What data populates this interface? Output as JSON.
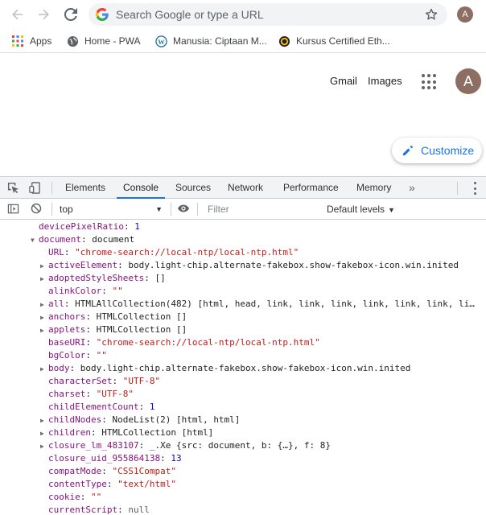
{
  "browser": {
    "omnibox_placeholder": "Search Google or type a URL",
    "profile_initial": "A"
  },
  "bookmarks": [
    {
      "label": "Apps",
      "icon": "apps-grid-icon"
    },
    {
      "label": "Home - PWA",
      "icon": "globe-icon"
    },
    {
      "label": "Manusia: Ciptaan M...",
      "icon": "wordpress-icon"
    },
    {
      "label": "Kursus Certified Eth...",
      "icon": "site-logo-icon"
    }
  ],
  "page": {
    "gmail": "Gmail",
    "images": "Images",
    "avatar_initial": "A",
    "customize": "Customize"
  },
  "devtools": {
    "tabs": [
      "Elements",
      "Console",
      "Sources",
      "Network",
      "Performance",
      "Memory"
    ],
    "active_tab": "Console",
    "more": "»",
    "context": "top",
    "filter_placeholder": "Filter",
    "levels": "Default levels"
  },
  "console": [
    {
      "indent": 0,
      "tri": "",
      "key": "devicePixelRatio",
      "value": "1",
      "type": "n",
      "keystyle": "k"
    },
    {
      "indent": 0,
      "tri": "▼",
      "key": "document",
      "value": "document",
      "type": "o",
      "keystyle": "k"
    },
    {
      "indent": 1,
      "tri": "",
      "key": "URL",
      "value": "\"chrome-search://local-ntp/local-ntp.html\"",
      "type": "s",
      "keystyle": "k"
    },
    {
      "indent": 1,
      "tri": "▶",
      "key": "activeElement",
      "value": "body.light-chip.alternate-fakebox.show-fakebox-icon.win.inited",
      "type": "o",
      "keystyle": "k"
    },
    {
      "indent": 1,
      "tri": "▶",
      "key": "adoptedStyleSheets",
      "value": "[]",
      "type": "o",
      "keystyle": "k"
    },
    {
      "indent": 1,
      "tri": "",
      "key": "alinkColor",
      "value": "\"\"",
      "type": "s",
      "keystyle": "k"
    },
    {
      "indent": 1,
      "tri": "▶",
      "key": "all",
      "value": "HTMLAllCollection(482) [html, head, link, link, link, link, link, link, li…",
      "type": "o",
      "keystyle": "k"
    },
    {
      "indent": 1,
      "tri": "▶",
      "key": "anchors",
      "value": "HTMLCollection []",
      "type": "o",
      "keystyle": "k"
    },
    {
      "indent": 1,
      "tri": "▶",
      "key": "applets",
      "value": "HTMLCollection []",
      "type": "o",
      "keystyle": "k"
    },
    {
      "indent": 1,
      "tri": "",
      "key": "baseURI",
      "value": "\"chrome-search://local-ntp/local-ntp.html\"",
      "type": "s",
      "keystyle": "k"
    },
    {
      "indent": 1,
      "tri": "",
      "key": "bgColor",
      "value": "\"\"",
      "type": "s",
      "keystyle": "k"
    },
    {
      "indent": 1,
      "tri": "▶",
      "key": "body",
      "value": "body.light-chip.alternate-fakebox.show-fakebox-icon.win.inited",
      "type": "o",
      "keystyle": "k"
    },
    {
      "indent": 1,
      "tri": "",
      "key": "characterSet",
      "value": "\"UTF-8\"",
      "type": "s",
      "keystyle": "k"
    },
    {
      "indent": 1,
      "tri": "",
      "key": "charset",
      "value": "\"UTF-8\"",
      "type": "s",
      "keystyle": "k"
    },
    {
      "indent": 1,
      "tri": "",
      "key": "childElementCount",
      "value": "1",
      "type": "n",
      "keystyle": "k"
    },
    {
      "indent": 1,
      "tri": "▶",
      "key": "childNodes",
      "value": "NodeList(2) [html, html]",
      "type": "o",
      "keystyle": "k"
    },
    {
      "indent": 1,
      "tri": "▶",
      "key": "children",
      "value": "HTMLCollection [html]",
      "type": "o",
      "keystyle": "k"
    },
    {
      "indent": 1,
      "tri": "▶",
      "key": "closure_lm_483107",
      "value": "_.Xe {src: document, b: {…}, f: 8}",
      "type": "o",
      "keystyle": "k"
    },
    {
      "indent": 1,
      "tri": "",
      "key": "closure_uid_955864138",
      "value": "13",
      "type": "n",
      "keystyle": "k"
    },
    {
      "indent": 1,
      "tri": "",
      "key": "compatMode",
      "value": "\"CSS1Compat\"",
      "type": "s",
      "keystyle": "k"
    },
    {
      "indent": 1,
      "tri": "",
      "key": "contentType",
      "value": "\"text/html\"",
      "type": "s",
      "keystyle": "k"
    },
    {
      "indent": 1,
      "tri": "",
      "key": "cookie",
      "value": "\"\"",
      "type": "s",
      "keystyle": "k"
    },
    {
      "indent": 1,
      "tri": "",
      "key": "currentScript",
      "value": "null",
      "type": "nl",
      "keystyle": "k"
    }
  ]
}
